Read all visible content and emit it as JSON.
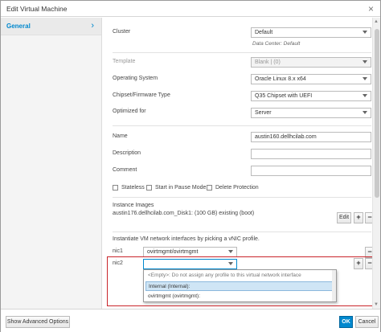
{
  "window": {
    "title": "Edit Virtual Machine",
    "close_icon": "×"
  },
  "sidebar": {
    "items": [
      {
        "label": "General"
      }
    ]
  },
  "form": {
    "cluster": {
      "label": "Cluster",
      "value": "Default",
      "hint": "Data Center: Default"
    },
    "template": {
      "label": "Template",
      "value": "Blank | (0)"
    },
    "os": {
      "label": "Operating System",
      "value": "Oracle Linux 8.x x64"
    },
    "chipset": {
      "label": "Chipset/Firmware Type",
      "value": "Q35 Chipset with UEFI"
    },
    "optimized": {
      "label": "Optimized for",
      "value": "Server"
    },
    "name": {
      "label": "Name",
      "value": "austin160.dellhcilab.com"
    },
    "description": {
      "label": "Description",
      "value": ""
    },
    "comment": {
      "label": "Comment",
      "value": ""
    },
    "checkboxes": [
      {
        "label": "Stateless",
        "checked": false
      },
      {
        "label": "Start in Pause Mode",
        "checked": false
      },
      {
        "label": "Delete Protection",
        "checked": false
      }
    ],
    "instance_images": {
      "label": "Instance Images",
      "disk": "austin176.dellhcilab.com_Disk1: (100 GB) existing (boot)",
      "edit_label": "Edit",
      "add": "+",
      "remove": "−"
    },
    "nic_section": {
      "label": "Instantiate VM network interfaces by picking a vNIC profile.",
      "nics": [
        {
          "name": "nic1",
          "value": "ovirtmgmt/ovirtmgmt"
        },
        {
          "name": "nic2",
          "value": ""
        }
      ],
      "dropdown_options": [
        "<Empty>: Do not assign any profile to this virtual network interface",
        "Internal (Internal):",
        "ovirtmgmt (ovirtmgmt):"
      ],
      "selected_option": 1,
      "add": "+",
      "remove": "−"
    }
  },
  "footer": {
    "advanced_label": "Show Advanced Options",
    "ok_label": "OK",
    "cancel_label": "Cancel"
  },
  "colors": {
    "accent": "#0088ce",
    "highlight_border": "#c9252b"
  }
}
